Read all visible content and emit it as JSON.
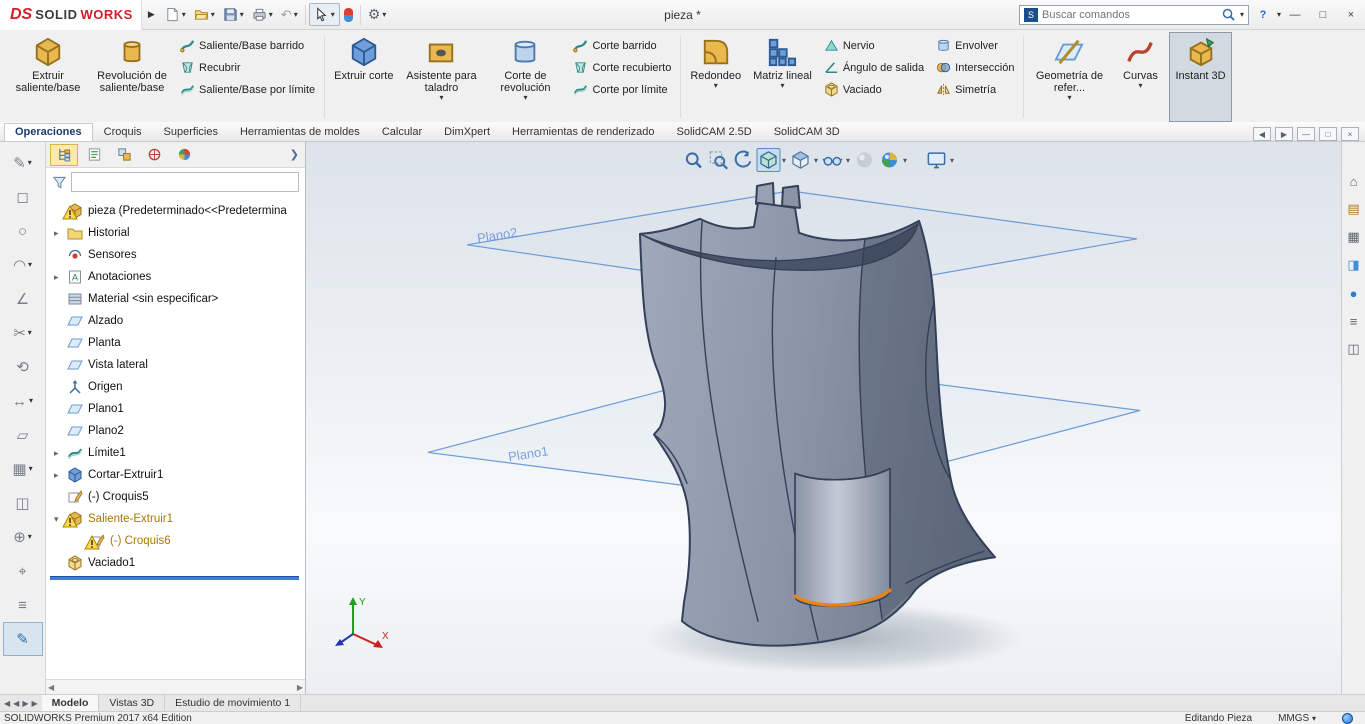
{
  "glyphs": {
    "caret": "▾",
    "arrow_right": "▸",
    "arrow_down": "▾",
    "chevron_right": "❯",
    "minimize": "—",
    "restore": "□",
    "close": "×",
    "help": "?",
    "pane_left": "◀",
    "pane_right": "▶",
    "nav_first": "◀",
    "nav_prev": "◀",
    "nav_next": "▶",
    "nav_last": "▶",
    "undo": "↶",
    "gear": "⚙",
    "funnel_note": "funnel-icon drawn as svg"
  },
  "titlebar": {
    "logo_mark": "DS",
    "logo_solid": "SOLID",
    "logo_works": "WORKS",
    "doc_title": "pieza *",
    "search_placeholder": "Buscar comandos"
  },
  "ribbon": {
    "extrude_boss": "Extruir saliente/base",
    "revolve_boss": "Revolución de saliente/base",
    "swept_boss": "Saliente/Base barrido",
    "loft": "Recubrir",
    "boundary_boss": "Saliente/Base por límite",
    "extrude_cut": "Extruir corte",
    "hole_wizard": "Asistente para taladro",
    "revolve_cut": "Corte de revolución",
    "swept_cut": "Corte barrido",
    "loft_cut": "Corte recubierto",
    "boundary_cut": "Corte por límite",
    "fillet": "Redondeo",
    "linear_pattern": "Matriz lineal",
    "rib": "Nervio",
    "draft": "Ángulo de salida",
    "shell": "Vaciado",
    "wrap": "Envolver",
    "intersect": "Intersección",
    "mirror": "Simetría",
    "ref_geometry": "Geometría de refer...",
    "curves": "Curvas",
    "instant3d": "Instant 3D"
  },
  "tabs": {
    "items": [
      "Operaciones",
      "Croquis",
      "Superficies",
      "Herramientas de moldes",
      "Calcular",
      "DimXpert",
      "Herramientas de renderizado",
      "SolidCAM 2.5D",
      "SolidCAM 3D"
    ],
    "active": "Operaciones"
  },
  "left_toolbar": {
    "glyphs": [
      "✎",
      "◻",
      "○",
      "◠",
      "∠",
      "✂",
      "⟲",
      "↔",
      "▱",
      "▦",
      "◫",
      "⊕",
      "⌖",
      "≡",
      "✎"
    ]
  },
  "tree": {
    "items": [
      "pieza  (Predeterminado<<Predetermina",
      "Historial",
      "Sensores",
      "Anotaciones",
      "Material <sin especificar>",
      "Alzado",
      "Planta",
      "Vista lateral",
      "Origen",
      "Plano1",
      "Plano2",
      "Límite1",
      "Cortar-Extruir1",
      "(-) Croquis5",
      "Saliente-Extruir1",
      "(-) Croquis6",
      "Vaciado1"
    ]
  },
  "viewport": {
    "plane1_label": "Plano1",
    "plane2_label": "Plano2",
    "triad_x": "X",
    "triad_y": "Y"
  },
  "task_pane": {
    "glyphs": [
      "⌂",
      "▤",
      "▦",
      "◨",
      "●",
      "≡",
      "◫"
    ]
  },
  "bottom_tabs": {
    "items": [
      "Modelo",
      "Vistas 3D",
      "Estudio de movimiento 1"
    ]
  },
  "statusbar": {
    "edition": "SOLIDWORKS Premium 2017 x64 Edition",
    "mode": "Editando Pieza",
    "units": "MMGS"
  }
}
